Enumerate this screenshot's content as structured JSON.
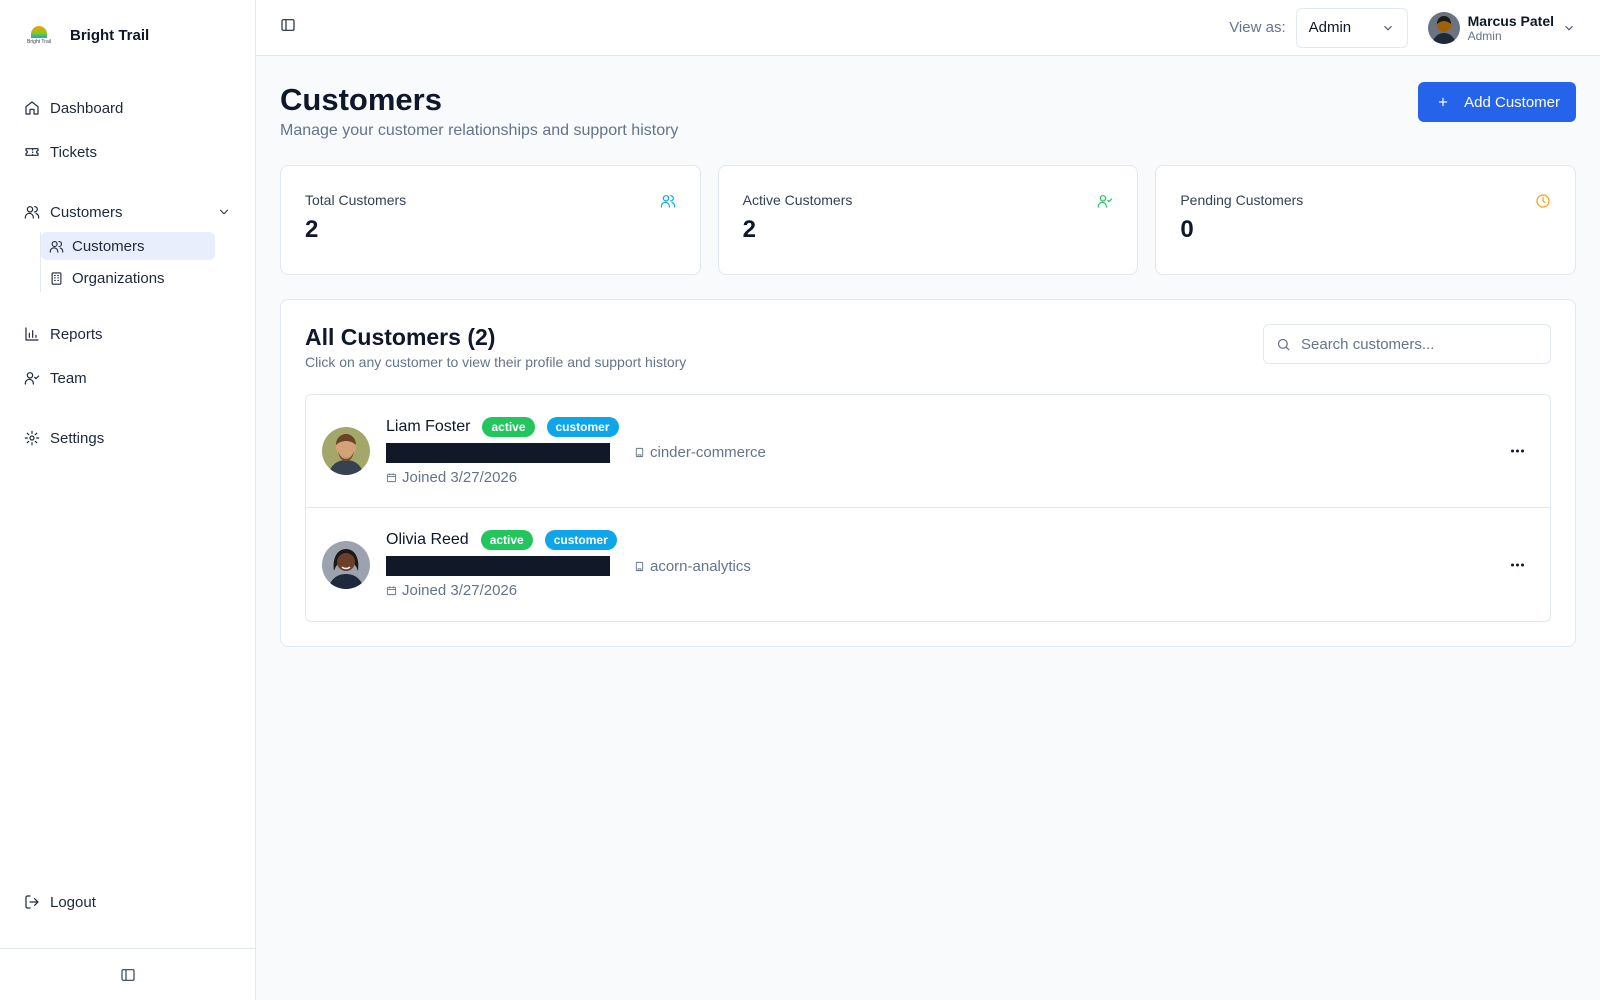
{
  "brand": {
    "name": "Bright Trail",
    "logo_text": "Bright Trail"
  },
  "sidebar": {
    "items": [
      {
        "label": "Dashboard",
        "icon": "home-icon"
      },
      {
        "label": "Tickets",
        "icon": "ticket-icon"
      },
      {
        "label": "Customers",
        "icon": "users-icon",
        "expanded": true
      },
      {
        "label": "Reports",
        "icon": "bar-chart-icon"
      },
      {
        "label": "Team",
        "icon": "user-check-icon"
      },
      {
        "label": "Settings",
        "icon": "gear-icon"
      }
    ],
    "sub_items": [
      {
        "label": "Customers",
        "icon": "users-icon",
        "active": true
      },
      {
        "label": "Organizations",
        "icon": "building-icon"
      }
    ],
    "logout": "Logout"
  },
  "topbar": {
    "view_as_label": "View as:",
    "view_as_value": "Admin",
    "user_name": "Marcus Patel",
    "user_role": "Admin"
  },
  "page": {
    "title": "Customers",
    "subtitle": "Manage your customer relationships and support history",
    "add_button": "Add Customer"
  },
  "stats": [
    {
      "label": "Total Customers",
      "value": "2",
      "icon": "users-icon",
      "color": "#0ea5e9"
    },
    {
      "label": "Active Customers",
      "value": "2",
      "icon": "user-check-icon",
      "color": "#22c55e"
    },
    {
      "label": "Pending Customers",
      "value": "0",
      "icon": "clock-icon",
      "color": "#f59e0b"
    }
  ],
  "list": {
    "title": "All Customers (2)",
    "subtitle": "Click on any customer to view their profile and support history",
    "search_placeholder": "Search customers...",
    "customers": [
      {
        "name": "Liam Foster",
        "status": "active",
        "role": "customer",
        "org": "cinder-commerce",
        "joined": "Joined 3/27/2026"
      },
      {
        "name": "Olivia Reed",
        "status": "active",
        "role": "customer",
        "org": "acorn-analytics",
        "joined": "Joined 3/27/2026"
      }
    ]
  },
  "colors": {
    "primary": "#2563eb",
    "active_badge": "#22c55e",
    "role_badge": "#0ea5e9",
    "sidebar_active": "#e8eefb"
  }
}
